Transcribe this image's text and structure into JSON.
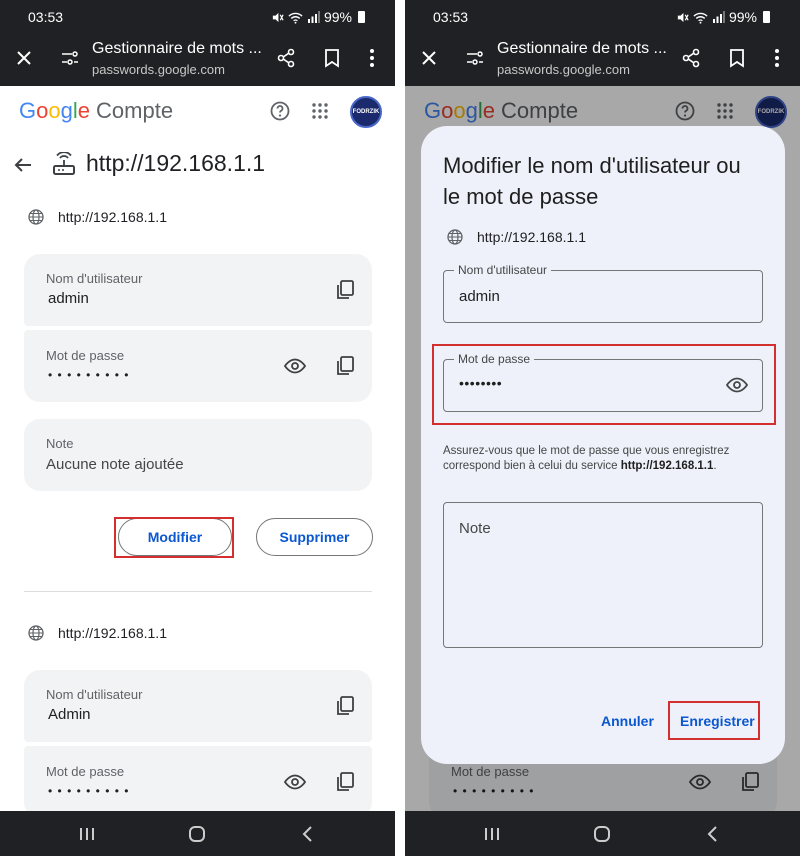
{
  "status": {
    "time": "03:53",
    "battery": "99%"
  },
  "toolbar": {
    "title": "Gestionnaire de mots ...",
    "url": "passwords.google.com"
  },
  "header": {
    "google_letters": [
      "G",
      "o",
      "o",
      "g",
      "l",
      "e"
    ],
    "compte": "Compte",
    "avatar_text": "FODRZIK"
  },
  "left": {
    "site_title": "http://192.168.1.1",
    "entry1": {
      "site": "http://192.168.1.1",
      "username_label": "Nom d'utilisateur",
      "username": "admin",
      "password_label": "Mot de passe",
      "password_mask": "• • • • • • • • •",
      "note_label": "Note",
      "note_value": "Aucune note ajoutée",
      "edit_button": "Modifier",
      "delete_button": "Supprimer"
    },
    "entry2": {
      "site": "http://192.168.1.1",
      "username_label": "Nom d'utilisateur",
      "username": "Admin",
      "password_label": "Mot de passe",
      "password_mask": "• • • • • • • • •"
    }
  },
  "dialog": {
    "title": "Modifier le nom d'utilisateur ou le mot de passe",
    "site": "http://192.168.1.1",
    "username_label": "Nom d'utilisateur",
    "username": "admin",
    "password_label": "Mot de passe",
    "password_mask": "••••••••",
    "helper_text": "Assurez-vous que le mot de passe que vous enregistrez correspond bien à celui du service ",
    "helper_site": "http://192.168.1.1",
    "helper_end": ".",
    "note_placeholder": "Note",
    "cancel_button": "Annuler",
    "save_button": "Enregistrer"
  },
  "behind_dialog": {
    "password_label": "Mot de passe",
    "password_mask": "• • • • • • • • •"
  },
  "colors": {
    "google_blue": "#4285F4",
    "google_red": "#EA4335",
    "google_yellow": "#FBBC05",
    "google_green": "#34A853",
    "highlight_red": "#d32f2f",
    "link_blue": "#0b57d0"
  }
}
